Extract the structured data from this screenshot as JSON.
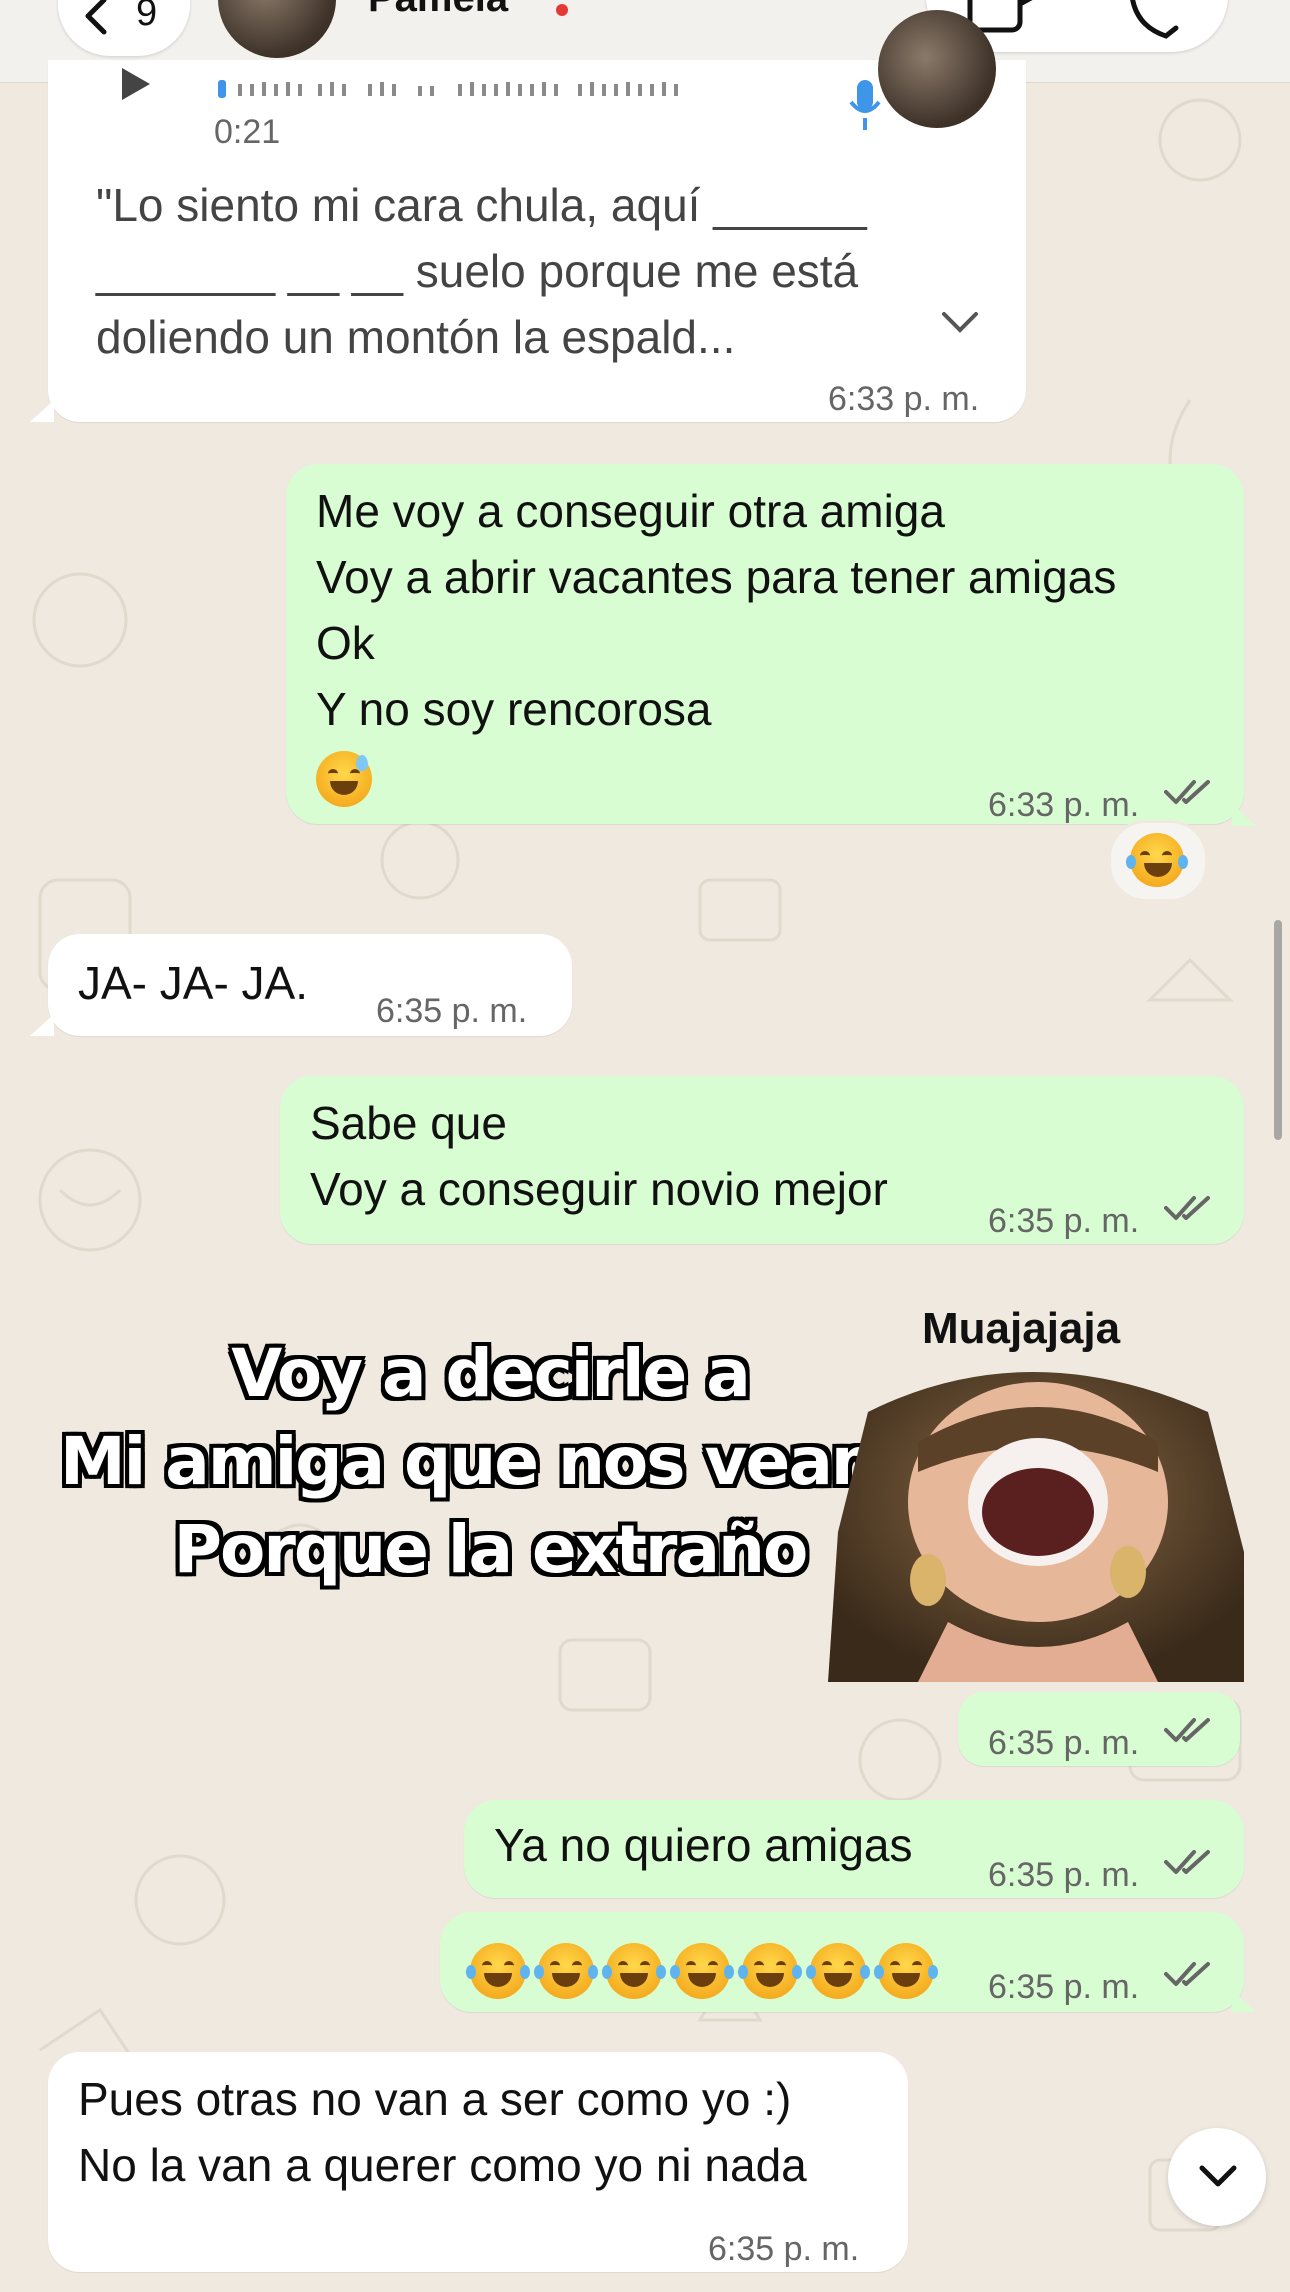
{
  "header": {
    "back_count": "9",
    "contact_name": "Pamela"
  },
  "voice_message": {
    "duration": "0:21",
    "transcript_lines": [
      "\"Lo siento mi cara chula, aquí ______",
      "_______ __ __ suelo porque me está",
      "doliendo un montón la espald..."
    ],
    "time": "6:33 p. m."
  },
  "messages": [
    {
      "direction": "out",
      "lines": [
        "Me voy a conseguir otra amiga",
        "Voy a abrir vacantes para tener amigas",
        "Ok",
        "Y no soy rencorosa",
        "😅"
      ],
      "time": "6:33 p. m.",
      "reaction": "😂"
    },
    {
      "direction": "in",
      "lines": [
        "JA- JA- JA."
      ],
      "time": "6:35 p. m."
    },
    {
      "direction": "out",
      "lines": [
        "Sabe que",
        "Voy a conseguir novio mejor"
      ],
      "time": "6:35 p. m."
    },
    {
      "direction": "out",
      "type": "sticker",
      "sticker_lines": [
        "Voy a decirle a",
        "Mi amiga que nos veamos",
        "Porque la extraño"
      ],
      "sticker_caption": "Muajajaja",
      "time": "6:35 p. m."
    },
    {
      "direction": "out",
      "lines": [
        "Ya no quiero amigas"
      ],
      "time": "6:35 p. m."
    },
    {
      "direction": "out",
      "lines": [
        "🤣🤣🤣🤣🤣🤣🤣"
      ],
      "emoji_count": 7,
      "time": "6:35 p. m."
    },
    {
      "direction": "in",
      "lines": [
        "Pues otras no van a ser como yo :)",
        "No la van a querer como yo ni nada"
      ],
      "time": "6:35 p. m."
    }
  ],
  "colors": {
    "background": "#efe9e0",
    "incoming_bubble": "#ffffff",
    "outgoing_bubble": "#d9fdd3",
    "mic_icon": "#3f95e8"
  }
}
